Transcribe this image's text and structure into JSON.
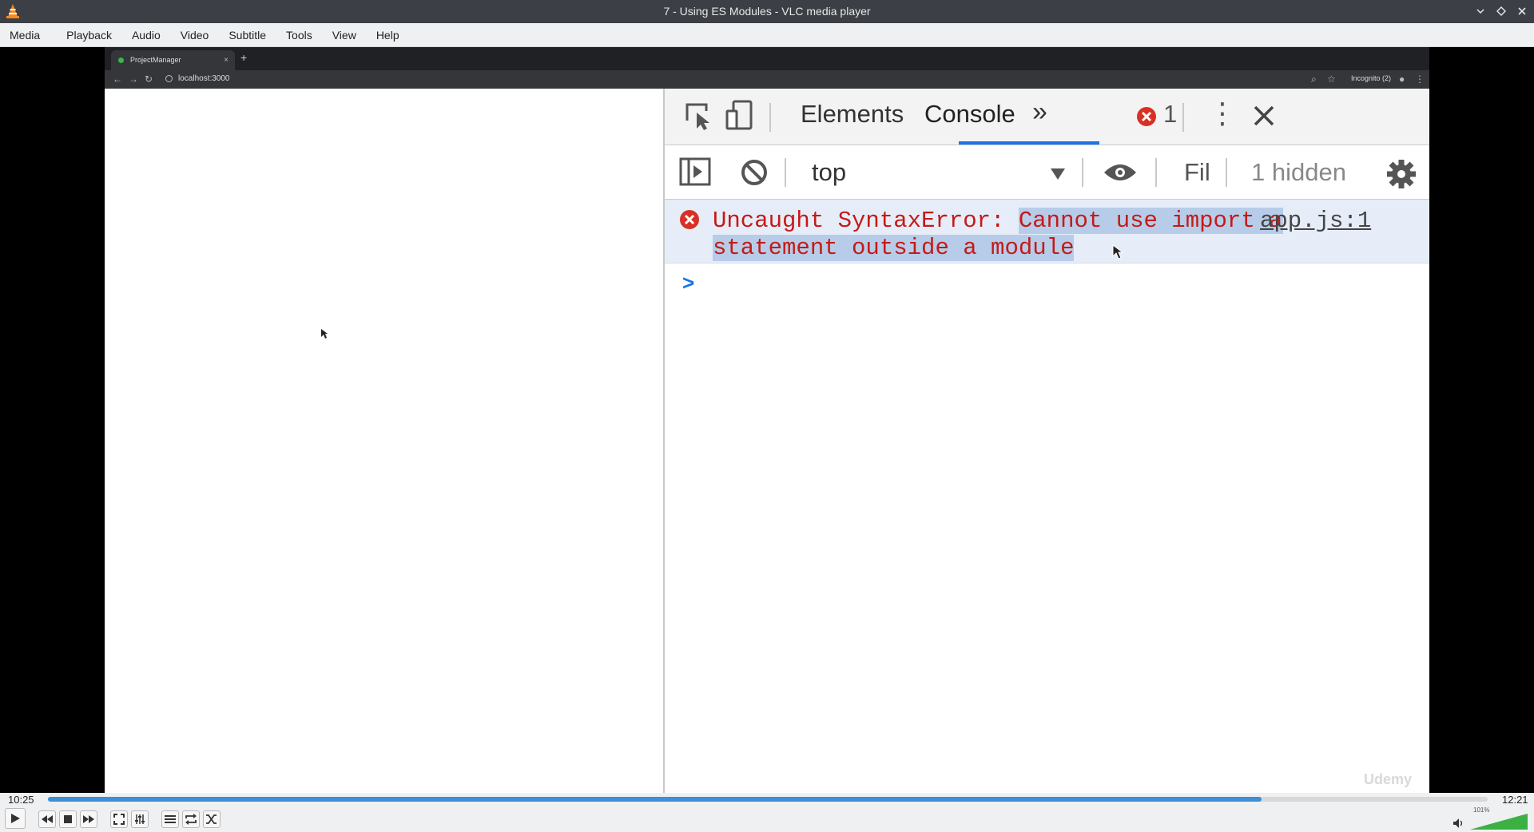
{
  "window": {
    "title": "7 - Using ES Modules - VLC media player"
  },
  "menu": [
    "Media",
    "Playback",
    "Audio",
    "Video",
    "Subtitle",
    "Tools",
    "View",
    "Help"
  ],
  "browser": {
    "tab_title": "ProjectManager",
    "new_tab": "+",
    "url": "localhost:3000",
    "profile": "Incognito (2)"
  },
  "devtools": {
    "tabs": {
      "elements": "Elements",
      "console": "Console"
    },
    "error_count": "1",
    "context": "top",
    "filter_placeholder": "Fil",
    "hidden": "1 hidden",
    "error": {
      "prefix": "Uncaught SyntaxError: ",
      "highlight_1": "Cannot use import a",
      "link": "app.js:1",
      "line2": "statement outside a module"
    },
    "prompt": ">",
    "watermark": "Udemy"
  },
  "player": {
    "elapsed": "10:25",
    "duration": "12:21",
    "progress": 0.843,
    "volume_label": "101%",
    "volume": 1.01
  }
}
